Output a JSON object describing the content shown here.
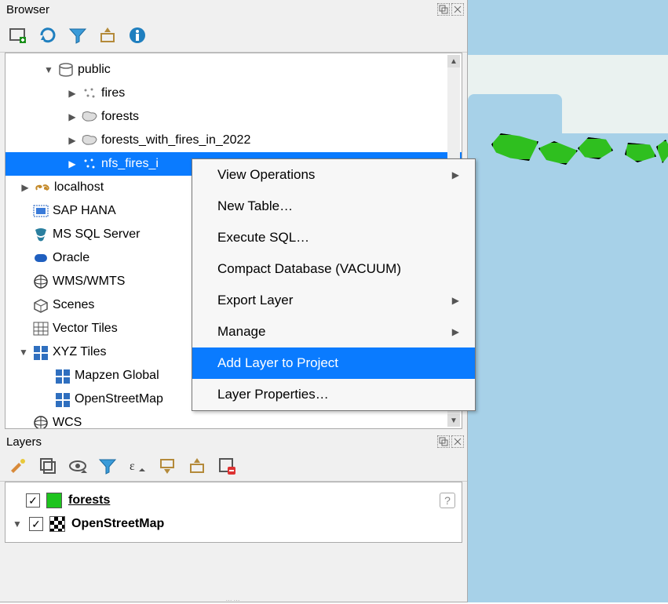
{
  "browser_panel": {
    "title": "Browser",
    "tree": {
      "public": {
        "label": "public"
      },
      "fires": {
        "label": "fires"
      },
      "forests": {
        "label": "forests"
      },
      "forests_with_fires": {
        "label": "forests_with_fires_in_2022"
      },
      "nfs_fires": {
        "label": "nfs_fires_i"
      },
      "localhost": {
        "label": "localhost"
      },
      "saphana": {
        "label": "SAP HANA"
      },
      "mssql": {
        "label": "MS SQL Server"
      },
      "oracle": {
        "label": "Oracle"
      },
      "wms": {
        "label": "WMS/WMTS"
      },
      "scenes": {
        "label": "Scenes"
      },
      "vectortiles": {
        "label": "Vector Tiles"
      },
      "xyz": {
        "label": "XYZ Tiles"
      },
      "mapzen": {
        "label": "Mapzen Global "
      },
      "osm": {
        "label": "OpenStreetMap"
      },
      "wcs": {
        "label": "WCS"
      }
    }
  },
  "context_menu": {
    "view_operations": "View Operations",
    "new_table": "New Table…",
    "execute_sql": "Execute SQL…",
    "compact": "Compact Database (VACUUM)",
    "export_layer": "Export Layer",
    "manage": "Manage",
    "add_layer": "Add Layer to Project",
    "layer_props": "Layer Properties…"
  },
  "layers_panel": {
    "title": "Layers",
    "layers": [
      {
        "name": "forests",
        "checked": true
      },
      {
        "name": "OpenStreetMap",
        "checked": true
      }
    ]
  }
}
